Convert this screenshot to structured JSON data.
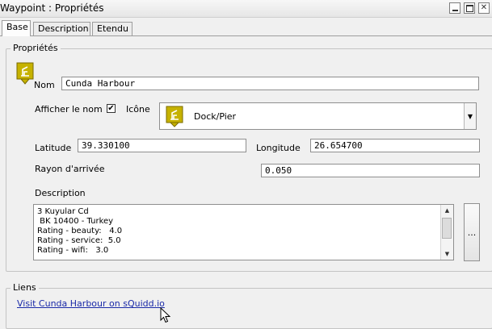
{
  "window": {
    "title": "Waypoint : Propriétés"
  },
  "tabs": [
    {
      "label": "Base",
      "active": true
    },
    {
      "label": "Description",
      "active": false
    },
    {
      "label": "Etendu",
      "active": false
    }
  ],
  "properties": {
    "legend": "Propriétés",
    "name_label": "Nom",
    "name_value": "Cunda Harbour",
    "show_name_label": "Afficher le nom",
    "show_name_checked": true,
    "icon_label": "Icône",
    "icon_selected": "Dock/Pier",
    "latitude_label": "Latitude",
    "latitude_value": "39.330100",
    "longitude_label": "Longitude",
    "longitude_value": "26.654700",
    "arrival_radius_label": "Rayon d'arrivée",
    "arrival_radius_value": "0.050",
    "description_label": "Description",
    "description_lines": [
      "3 Kuyular Cd",
      " BK 10400 - Turkey",
      "Rating - beauty:   4.0",
      "Rating - service:  5.0",
      "Rating - wifi:   3.0"
    ],
    "more_button": "..."
  },
  "links": {
    "legend": "Liens",
    "link_text": "Visit Cunda Harbour on sQuidd.io"
  },
  "colors": {
    "icon_yellow": "#c6b200",
    "link_blue": "#1a2aa8"
  }
}
